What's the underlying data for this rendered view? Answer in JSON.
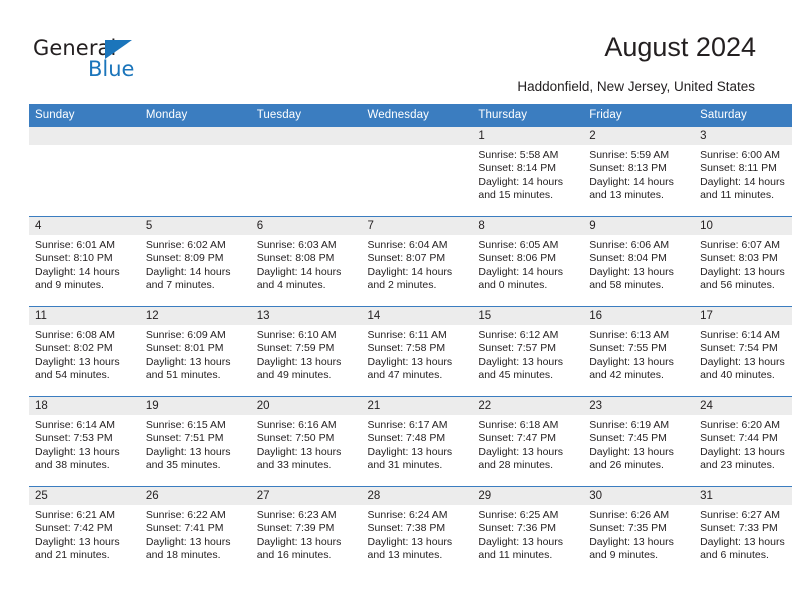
{
  "brand": {
    "name_top": "General",
    "name_bottom": "Blue",
    "triangle_color": "#1b75bb"
  },
  "header": {
    "title": "August 2024",
    "location": "Haddonfield, New Jersey, United States",
    "header_bg": "#3b7dc0",
    "daynum_bg": "#ececec"
  },
  "weekdays": [
    "Sunday",
    "Monday",
    "Tuesday",
    "Wednesday",
    "Thursday",
    "Friday",
    "Saturday"
  ],
  "labels": {
    "sunrise": "Sunrise:",
    "sunset": "Sunset:",
    "daylight": "Daylight:"
  },
  "weeks": [
    [
      {
        "day": "",
        "sunrise": "",
        "sunset": "",
        "daylight1": "",
        "daylight2": ""
      },
      {
        "day": "",
        "sunrise": "",
        "sunset": "",
        "daylight1": "",
        "daylight2": ""
      },
      {
        "day": "",
        "sunrise": "",
        "sunset": "",
        "daylight1": "",
        "daylight2": ""
      },
      {
        "day": "",
        "sunrise": "",
        "sunset": "",
        "daylight1": "",
        "daylight2": ""
      },
      {
        "day": "1",
        "sunrise": "Sunrise: 5:58 AM",
        "sunset": "Sunset: 8:14 PM",
        "daylight1": "Daylight: 14 hours",
        "daylight2": "and 15 minutes."
      },
      {
        "day": "2",
        "sunrise": "Sunrise: 5:59 AM",
        "sunset": "Sunset: 8:13 PM",
        "daylight1": "Daylight: 14 hours",
        "daylight2": "and 13 minutes."
      },
      {
        "day": "3",
        "sunrise": "Sunrise: 6:00 AM",
        "sunset": "Sunset: 8:11 PM",
        "daylight1": "Daylight: 14 hours",
        "daylight2": "and 11 minutes."
      }
    ],
    [
      {
        "day": "4",
        "sunrise": "Sunrise: 6:01 AM",
        "sunset": "Sunset: 8:10 PM",
        "daylight1": "Daylight: 14 hours",
        "daylight2": "and 9 minutes."
      },
      {
        "day": "5",
        "sunrise": "Sunrise: 6:02 AM",
        "sunset": "Sunset: 8:09 PM",
        "daylight1": "Daylight: 14 hours",
        "daylight2": "and 7 minutes."
      },
      {
        "day": "6",
        "sunrise": "Sunrise: 6:03 AM",
        "sunset": "Sunset: 8:08 PM",
        "daylight1": "Daylight: 14 hours",
        "daylight2": "and 4 minutes."
      },
      {
        "day": "7",
        "sunrise": "Sunrise: 6:04 AM",
        "sunset": "Sunset: 8:07 PM",
        "daylight1": "Daylight: 14 hours",
        "daylight2": "and 2 minutes."
      },
      {
        "day": "8",
        "sunrise": "Sunrise: 6:05 AM",
        "sunset": "Sunset: 8:06 PM",
        "daylight1": "Daylight: 14 hours",
        "daylight2": "and 0 minutes."
      },
      {
        "day": "9",
        "sunrise": "Sunrise: 6:06 AM",
        "sunset": "Sunset: 8:04 PM",
        "daylight1": "Daylight: 13 hours",
        "daylight2": "and 58 minutes."
      },
      {
        "day": "10",
        "sunrise": "Sunrise: 6:07 AM",
        "sunset": "Sunset: 8:03 PM",
        "daylight1": "Daylight: 13 hours",
        "daylight2": "and 56 minutes."
      }
    ],
    [
      {
        "day": "11",
        "sunrise": "Sunrise: 6:08 AM",
        "sunset": "Sunset: 8:02 PM",
        "daylight1": "Daylight: 13 hours",
        "daylight2": "and 54 minutes."
      },
      {
        "day": "12",
        "sunrise": "Sunrise: 6:09 AM",
        "sunset": "Sunset: 8:01 PM",
        "daylight1": "Daylight: 13 hours",
        "daylight2": "and 51 minutes."
      },
      {
        "day": "13",
        "sunrise": "Sunrise: 6:10 AM",
        "sunset": "Sunset: 7:59 PM",
        "daylight1": "Daylight: 13 hours",
        "daylight2": "and 49 minutes."
      },
      {
        "day": "14",
        "sunrise": "Sunrise: 6:11 AM",
        "sunset": "Sunset: 7:58 PM",
        "daylight1": "Daylight: 13 hours",
        "daylight2": "and 47 minutes."
      },
      {
        "day": "15",
        "sunrise": "Sunrise: 6:12 AM",
        "sunset": "Sunset: 7:57 PM",
        "daylight1": "Daylight: 13 hours",
        "daylight2": "and 45 minutes."
      },
      {
        "day": "16",
        "sunrise": "Sunrise: 6:13 AM",
        "sunset": "Sunset: 7:55 PM",
        "daylight1": "Daylight: 13 hours",
        "daylight2": "and 42 minutes."
      },
      {
        "day": "17",
        "sunrise": "Sunrise: 6:14 AM",
        "sunset": "Sunset: 7:54 PM",
        "daylight1": "Daylight: 13 hours",
        "daylight2": "and 40 minutes."
      }
    ],
    [
      {
        "day": "18",
        "sunrise": "Sunrise: 6:14 AM",
        "sunset": "Sunset: 7:53 PM",
        "daylight1": "Daylight: 13 hours",
        "daylight2": "and 38 minutes."
      },
      {
        "day": "19",
        "sunrise": "Sunrise: 6:15 AM",
        "sunset": "Sunset: 7:51 PM",
        "daylight1": "Daylight: 13 hours",
        "daylight2": "and 35 minutes."
      },
      {
        "day": "20",
        "sunrise": "Sunrise: 6:16 AM",
        "sunset": "Sunset: 7:50 PM",
        "daylight1": "Daylight: 13 hours",
        "daylight2": "and 33 minutes."
      },
      {
        "day": "21",
        "sunrise": "Sunrise: 6:17 AM",
        "sunset": "Sunset: 7:48 PM",
        "daylight1": "Daylight: 13 hours",
        "daylight2": "and 31 minutes."
      },
      {
        "day": "22",
        "sunrise": "Sunrise: 6:18 AM",
        "sunset": "Sunset: 7:47 PM",
        "daylight1": "Daylight: 13 hours",
        "daylight2": "and 28 minutes."
      },
      {
        "day": "23",
        "sunrise": "Sunrise: 6:19 AM",
        "sunset": "Sunset: 7:45 PM",
        "daylight1": "Daylight: 13 hours",
        "daylight2": "and 26 minutes."
      },
      {
        "day": "24",
        "sunrise": "Sunrise: 6:20 AM",
        "sunset": "Sunset: 7:44 PM",
        "daylight1": "Daylight: 13 hours",
        "daylight2": "and 23 minutes."
      }
    ],
    [
      {
        "day": "25",
        "sunrise": "Sunrise: 6:21 AM",
        "sunset": "Sunset: 7:42 PM",
        "daylight1": "Daylight: 13 hours",
        "daylight2": "and 21 minutes."
      },
      {
        "day": "26",
        "sunrise": "Sunrise: 6:22 AM",
        "sunset": "Sunset: 7:41 PM",
        "daylight1": "Daylight: 13 hours",
        "daylight2": "and 18 minutes."
      },
      {
        "day": "27",
        "sunrise": "Sunrise: 6:23 AM",
        "sunset": "Sunset: 7:39 PM",
        "daylight1": "Daylight: 13 hours",
        "daylight2": "and 16 minutes."
      },
      {
        "day": "28",
        "sunrise": "Sunrise: 6:24 AM",
        "sunset": "Sunset: 7:38 PM",
        "daylight1": "Daylight: 13 hours",
        "daylight2": "and 13 minutes."
      },
      {
        "day": "29",
        "sunrise": "Sunrise: 6:25 AM",
        "sunset": "Sunset: 7:36 PM",
        "daylight1": "Daylight: 13 hours",
        "daylight2": "and 11 minutes."
      },
      {
        "day": "30",
        "sunrise": "Sunrise: 6:26 AM",
        "sunset": "Sunset: 7:35 PM",
        "daylight1": "Daylight: 13 hours",
        "daylight2": "and 9 minutes."
      },
      {
        "day": "31",
        "sunrise": "Sunrise: 6:27 AM",
        "sunset": "Sunset: 7:33 PM",
        "daylight1": "Daylight: 13 hours",
        "daylight2": "and 6 minutes."
      }
    ]
  ]
}
